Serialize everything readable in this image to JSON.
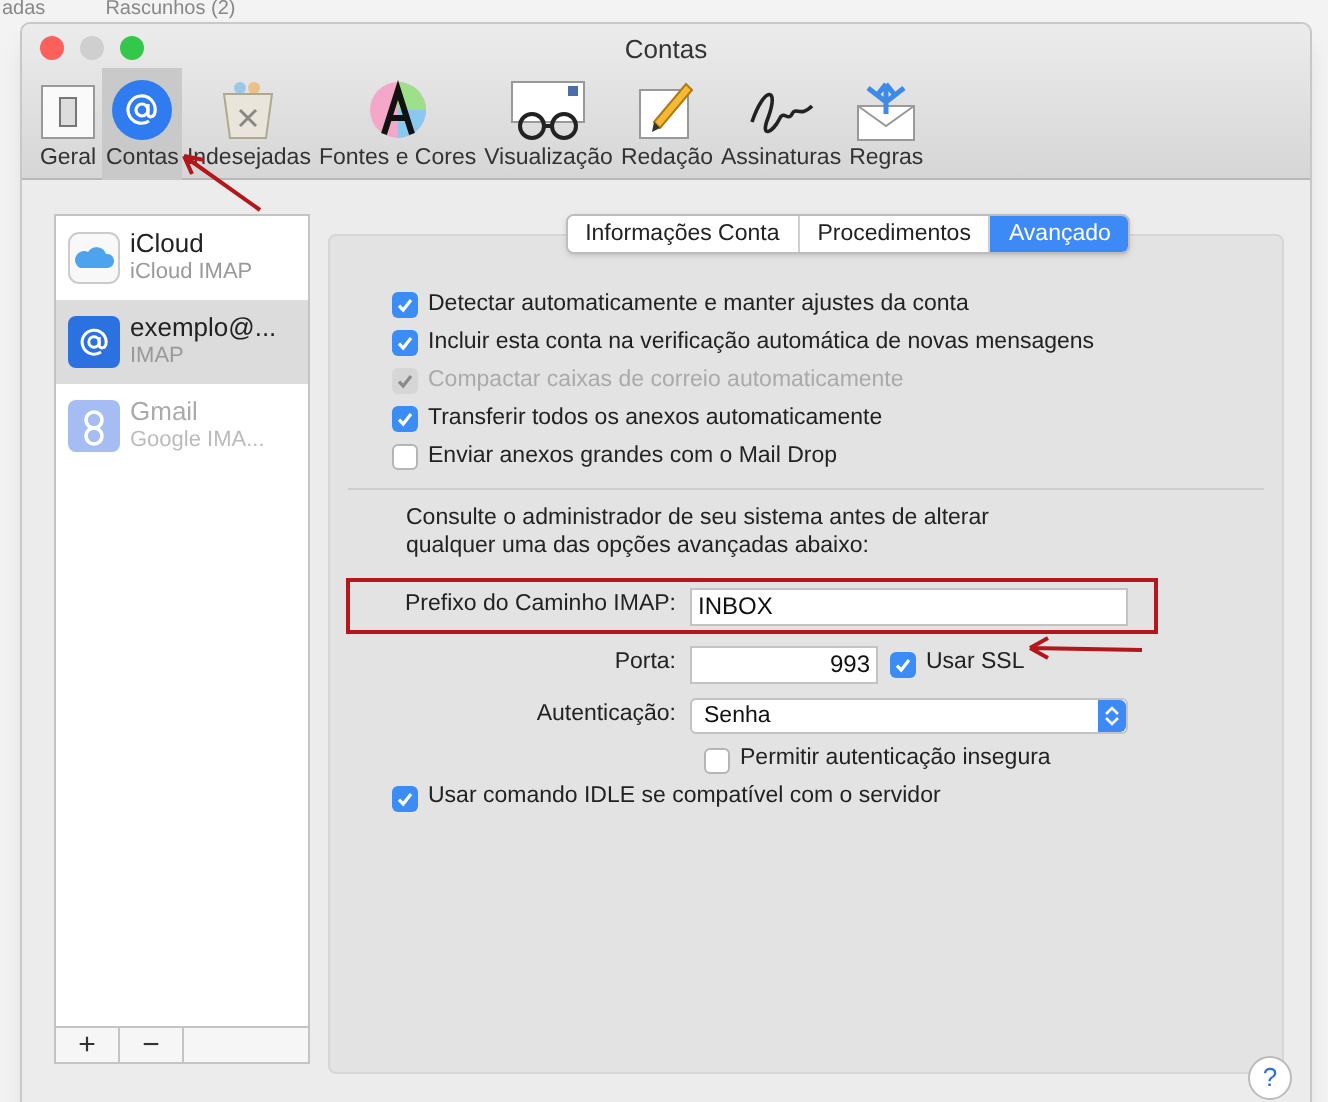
{
  "background": {
    "top_texts": [
      "adas",
      "Rascunhos (2)"
    ]
  },
  "window": {
    "title": "Contas"
  },
  "toolbar": [
    {
      "label": "Geral",
      "selected": false,
      "kind": "switch"
    },
    {
      "label": "Contas",
      "selected": true,
      "kind": "at"
    },
    {
      "label": "Indesejadas",
      "selected": false,
      "kind": "trash"
    },
    {
      "label": "Fontes e Cores",
      "selected": false,
      "kind": "font"
    },
    {
      "label": "Visualização",
      "selected": false,
      "kind": "glasses"
    },
    {
      "label": "Redação",
      "selected": false,
      "kind": "pencil"
    },
    {
      "label": "Assinaturas",
      "selected": false,
      "kind": "signature"
    },
    {
      "label": "Regras",
      "selected": false,
      "kind": "rules"
    }
  ],
  "accounts": [
    {
      "name": "iCloud",
      "type": "iCloud IMAP",
      "selected": false,
      "disabled": false,
      "kind": "icloud"
    },
    {
      "name": "exemplo@...",
      "type": "IMAP",
      "selected": true,
      "disabled": false,
      "kind": "at"
    },
    {
      "name": "Gmail",
      "type": "Google IMA...",
      "selected": false,
      "disabled": true,
      "kind": "google"
    }
  ],
  "list_buttons": [
    "+",
    "−"
  ],
  "tabs": [
    {
      "label": "Informações Conta",
      "selected": false
    },
    {
      "label": "Procedimentos",
      "selected": false
    },
    {
      "label": "Avançado",
      "selected": true
    }
  ],
  "options": [
    {
      "label": "Detectar automaticamente e manter ajustes da conta",
      "checked": true,
      "disabled": false
    },
    {
      "label": "Incluir esta conta na verificação automática de novas mensagens",
      "checked": true,
      "disabled": false
    },
    {
      "label": "Compactar caixas de correio automaticamente",
      "checked": true,
      "disabled": true
    },
    {
      "label": "Transferir todos os anexos automaticamente",
      "checked": true,
      "disabled": false
    },
    {
      "label": "Enviar anexos grandes com o Mail Drop",
      "checked": false,
      "disabled": false
    }
  ],
  "notice": "Consulte o administrador de seu sistema antes de alterar qualquer uma das opções avançadas abaixo:",
  "prefix": {
    "label": "Prefixo do Caminho IMAP:",
    "value": "INBOX",
    "highlighted": true
  },
  "port": {
    "label": "Porta:",
    "value": "993"
  },
  "ssl": {
    "label": "Usar SSL",
    "checked": true
  },
  "auth": {
    "label": "Autenticação:",
    "value": "Senha"
  },
  "insecure": {
    "label": "Permitir autenticação insegura",
    "checked": false
  },
  "idle": {
    "label": "Usar comando IDLE se compatível com o servidor",
    "checked": true
  },
  "help": "?"
}
